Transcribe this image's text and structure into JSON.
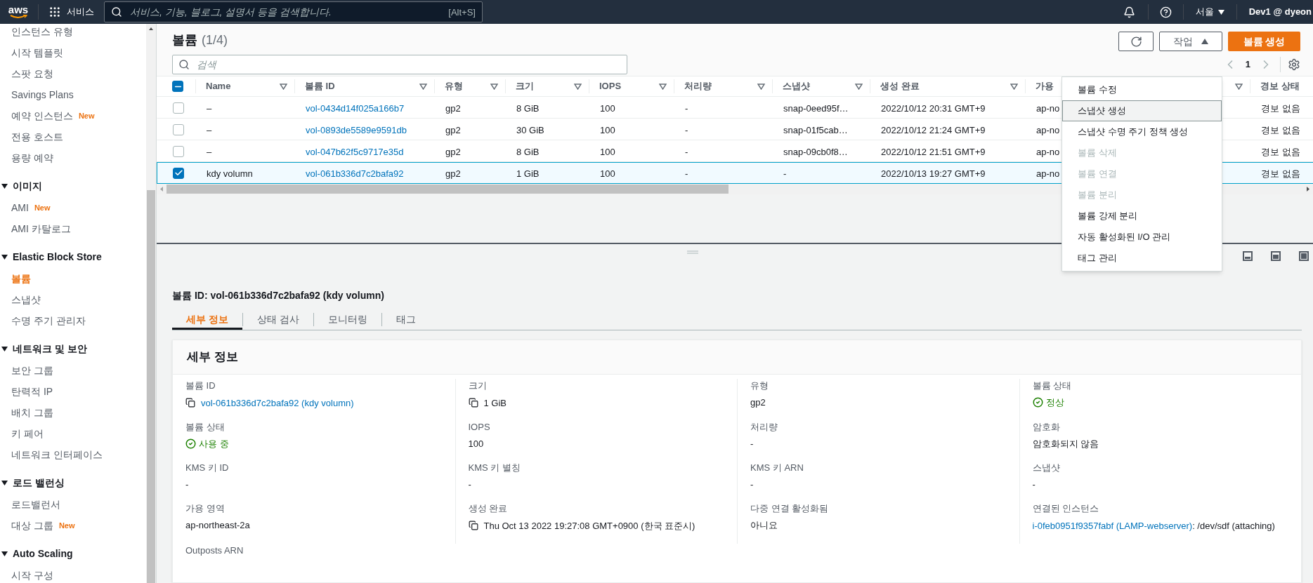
{
  "nav": {
    "logo": "aws",
    "services": "서비스",
    "search_placeholder": "서비스, 기능, 블로그, 설명서 등을 검색합니다.",
    "shortcut": "[Alt+S]",
    "region": "서울",
    "account": "Dev1 @ dyeon"
  },
  "sidebar": {
    "items": [
      {
        "label": "인스턴스 유형",
        "selected": false
      },
      {
        "label": "시작 템플릿",
        "selected": false
      },
      {
        "label": "스팟 요청",
        "selected": false
      },
      {
        "label": "Savings Plans",
        "selected": false
      },
      {
        "label": "예약 인스턴스",
        "badge": "New",
        "selected": false
      },
      {
        "label": "전용 호스트",
        "selected": false
      },
      {
        "label": "용량 예약",
        "selected": false
      }
    ],
    "sections": [
      {
        "title": "이미지",
        "expanded": true,
        "items": [
          {
            "label": "AMI",
            "badge": "New",
            "selected": false
          },
          {
            "label": "AMI 카탈로그",
            "selected": false
          }
        ]
      },
      {
        "title": "Elastic Block Store",
        "expanded": true,
        "items": [
          {
            "label": "볼륨",
            "selected": true
          },
          {
            "label": "스냅샷",
            "selected": false
          },
          {
            "label": "수명 주기 관리자",
            "selected": false
          }
        ]
      },
      {
        "title": "네트워크 및 보안",
        "expanded": true,
        "items": [
          {
            "label": "보안 그룹",
            "selected": false
          },
          {
            "label": "탄력적 IP",
            "selected": false
          },
          {
            "label": "배치 그룹",
            "selected": false
          },
          {
            "label": "키 페어",
            "selected": false
          },
          {
            "label": "네트워크 인터페이스",
            "selected": false
          }
        ]
      },
      {
        "title": "로드 밸런싱",
        "expanded": true,
        "items": [
          {
            "label": "로드밸런서",
            "selected": false
          },
          {
            "label": "대상 그룹",
            "badge": "New",
            "selected": false
          }
        ]
      },
      {
        "title": "Auto Scaling",
        "expanded": true,
        "items": [
          {
            "label": "시작 구성",
            "selected": false
          }
        ]
      }
    ]
  },
  "volumes": {
    "title": "볼륨",
    "count": "(1/4)",
    "search_placeholder": "검색",
    "actions_label": "작업",
    "create_label": "볼륨 생성",
    "page": "1",
    "select_all_partial": true,
    "columns": [
      {
        "label": "Name",
        "kind": "text"
      },
      {
        "label": "볼륨 ID",
        "kind": "link"
      },
      {
        "label": "유형",
        "kind": "text"
      },
      {
        "label": "크기",
        "kind": "text"
      },
      {
        "label": "IOPS",
        "kind": "text"
      },
      {
        "label": "처리량",
        "kind": "text"
      },
      {
        "label": "스냅샷",
        "kind": "text"
      },
      {
        "label": "생성 완료",
        "kind": "text"
      },
      {
        "label": "가용",
        "kind": "text"
      },
      {
        "label": "경보 상태",
        "kind": "text"
      }
    ],
    "rows": [
      {
        "selected": false,
        "cells": [
          "–",
          "vol-0434d14f025a166b7",
          "gp2",
          "8 GiB",
          "100",
          "-",
          "snap-0eed95f…",
          "2022/10/12 20:31 GMT+9",
          "ap-no",
          "경보 없음"
        ]
      },
      {
        "selected": false,
        "cells": [
          "–",
          "vol-0893de5589e9591db",
          "gp2",
          "30 GiB",
          "100",
          "-",
          "snap-01f5cab…",
          "2022/10/12 21:24 GMT+9",
          "ap-no",
          "경보 없음"
        ]
      },
      {
        "selected": false,
        "cells": [
          "–",
          "vol-047b62f5c9717e35d",
          "gp2",
          "8 GiB",
          "100",
          "-",
          "snap-09cb0f8…",
          "2022/10/12 21:51 GMT+9",
          "ap-no",
          "경보 없음"
        ]
      },
      {
        "selected": true,
        "cells": [
          "kdy volumn",
          "vol-061b336d7c2bafa92",
          "gp2",
          "1 GiB",
          "100",
          "-",
          "-",
          "2022/10/13 19:27 GMT+9",
          "ap-no",
          "경보 없음"
        ]
      }
    ]
  },
  "actions_menu": {
    "open": true,
    "items": [
      {
        "label": "볼륨 수정",
        "disabled": false,
        "highlighted": false
      },
      {
        "label": "스냅샷 생성",
        "disabled": false,
        "highlighted": true
      },
      {
        "label": "스냅샷 수명 주기 정책 생성",
        "disabled": false,
        "highlighted": false
      },
      {
        "label": "볼륨 삭제",
        "disabled": true,
        "highlighted": false
      },
      {
        "label": "볼륨 연결",
        "disabled": true,
        "highlighted": false
      },
      {
        "label": "볼륨 분리",
        "disabled": true,
        "highlighted": false
      },
      {
        "label": "볼륨 강제 분리",
        "disabled": false,
        "highlighted": false
      },
      {
        "label": "자동 활성화된 I/O 관리",
        "disabled": false,
        "highlighted": false
      },
      {
        "label": "태그 관리",
        "disabled": false,
        "highlighted": false
      }
    ]
  },
  "detail": {
    "title": "볼륨 ID: vol-061b336d7c2bafa92 (kdy volumn)",
    "tabs": [
      {
        "label": "세부 정보",
        "selected": true
      },
      {
        "label": "상태 검사",
        "selected": false
      },
      {
        "label": "모니터링",
        "selected": false
      },
      {
        "label": "태그",
        "selected": false
      }
    ],
    "card_title": "세부 정보",
    "fields": [
      {
        "label": "볼륨 ID",
        "kind": "copy_link",
        "value": "vol-061b336d7c2bafa92 (kdy volumn)"
      },
      {
        "label": "크기",
        "kind": "copy",
        "value": "1 GiB"
      },
      {
        "label": "유형",
        "kind": "text",
        "value": "gp2"
      },
      {
        "label": "볼륨 상태",
        "kind": "status",
        "value": "정상"
      },
      {
        "label": "볼륨 상태",
        "kind": "status",
        "value": "사용 중"
      },
      {
        "label": "IOPS",
        "kind": "text",
        "value": "100"
      },
      {
        "label": "처리량",
        "kind": "text",
        "value": "-"
      },
      {
        "label": "암호화",
        "kind": "text",
        "value": "암호화되지 않음"
      },
      {
        "label": "KMS 키 ID",
        "kind": "text",
        "value": "-"
      },
      {
        "label": "KMS 키 별칭",
        "kind": "text",
        "value": "-"
      },
      {
        "label": "KMS 키 ARN",
        "kind": "text",
        "value": "-"
      },
      {
        "label": "스냅샷",
        "kind": "text",
        "value": "-"
      },
      {
        "label": "가용 영역",
        "kind": "text",
        "value": "ap-northeast-2a"
      },
      {
        "label": "생성 완료",
        "kind": "copy",
        "value": "Thu Oct 13 2022 19:27:08 GMT+0900 (한국 표준시)"
      },
      {
        "label": "다중 연결 활성화됨",
        "kind": "text",
        "value": "아니요"
      },
      {
        "label": "연결된 인스턴스",
        "kind": "link_text",
        "link": "i-0feb0951f9357fabf (LAMP-webserver)",
        "value": ": /dev/sdf (attaching)"
      },
      {
        "label": "Outposts ARN",
        "kind": "text"
      }
    ]
  }
}
